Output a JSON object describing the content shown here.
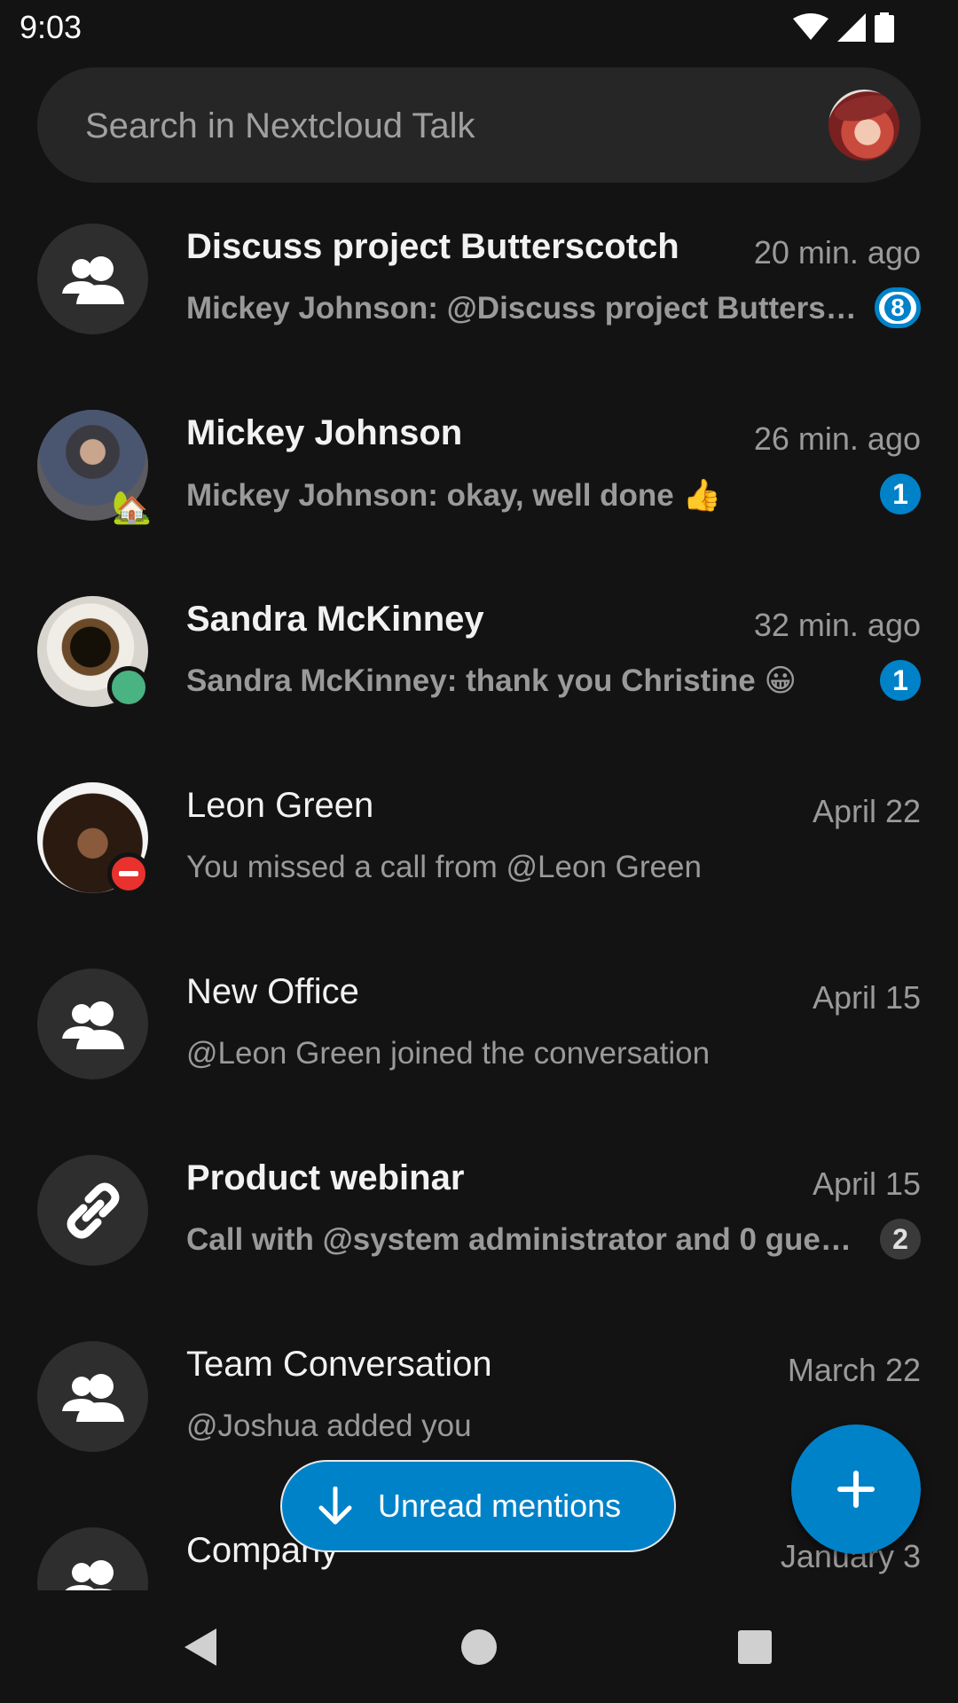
{
  "status_bar": {
    "time": "9:03"
  },
  "search": {
    "placeholder": "Search in Nextcloud Talk"
  },
  "conversations": [
    {
      "title": "Discuss project Butterscotch",
      "time": "20 min. ago",
      "preview": "Mickey Johnson: @Discuss project Butterscotch",
      "unread": "8",
      "bold": true,
      "avatar": "group-icon"
    },
    {
      "title": "Mickey Johnson",
      "time": "26 min. ago",
      "preview": "Mickey Johnson: okay, well done 👍",
      "unread": "1",
      "bold": true,
      "avatar": "user-photo",
      "status": "🏡"
    },
    {
      "title": "Sandra McKinney",
      "time": "32 min. ago",
      "preview": "Sandra McKinney: thank you Christine 😀",
      "unread": "1",
      "bold": true,
      "avatar": "user-photo",
      "status": "online"
    },
    {
      "title": "Leon Green",
      "time": "April 22",
      "preview": "You missed a call from @Leon Green",
      "bold": false,
      "avatar": "user-photo",
      "status": "do-not-disturb"
    },
    {
      "title": "New Office",
      "time": "April 15",
      "preview": "@Leon Green joined the conversation",
      "bold": false,
      "avatar": "group-icon"
    },
    {
      "title": "Product webinar",
      "time": "April 15",
      "preview": "Call with @system administrator and 0 guests",
      "unread": "2",
      "bold": true,
      "avatar": "link-icon"
    },
    {
      "title": "Team Conversation",
      "time": "March 22",
      "preview": "@Joshua added you",
      "bold": false,
      "avatar": "group-icon"
    },
    {
      "title": "Company",
      "time": "January 3",
      "preview": "",
      "bold": false,
      "avatar": "group-icon"
    }
  ],
  "unread_mentions_button": {
    "label": "Unread mentions"
  },
  "colors": {
    "accent": "#0082c9",
    "background": "#131313",
    "online": "#49b382",
    "dnd": "#e9322d"
  }
}
